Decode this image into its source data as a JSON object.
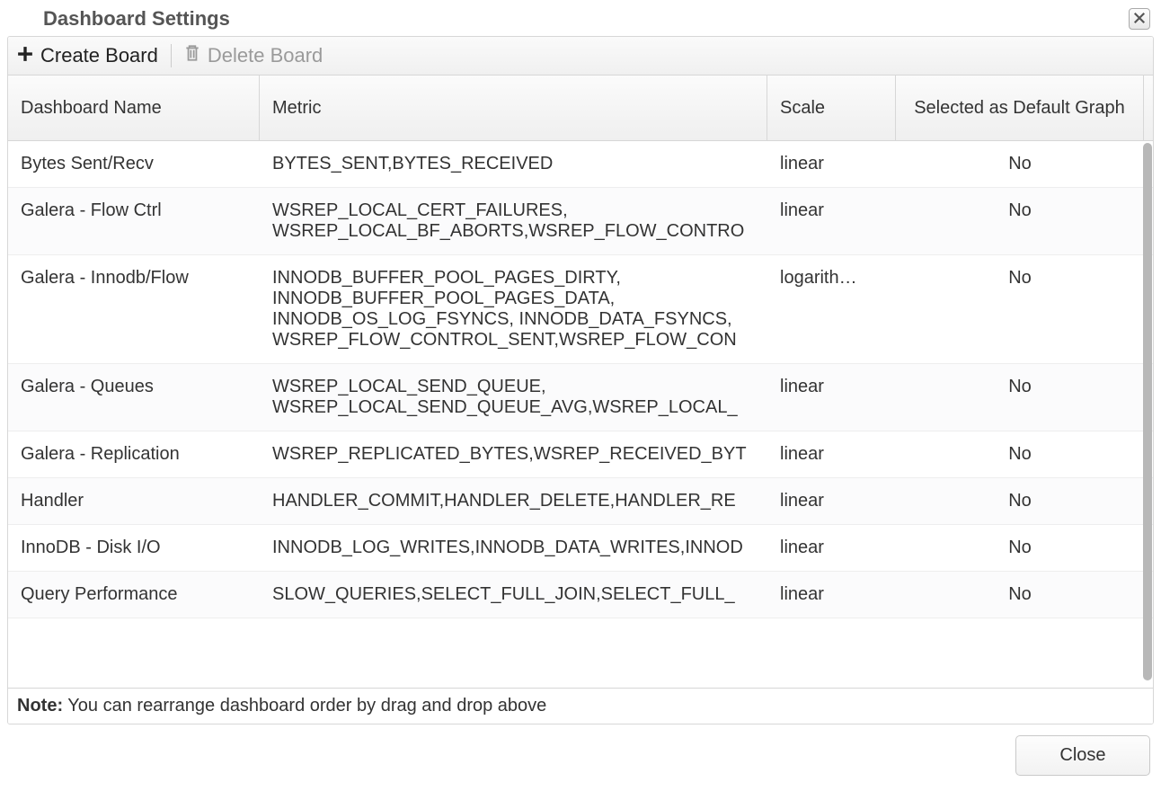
{
  "dialog": {
    "title": "Dashboard Settings"
  },
  "toolbar": {
    "create_label": "Create Board",
    "delete_label": "Delete Board"
  },
  "columns": {
    "name": "Dashboard Name",
    "metric": "Metric",
    "scale": "Scale",
    "default": "Selected as Default Graph"
  },
  "rows": [
    {
      "name": "Bytes Sent/Recv",
      "metric": "BYTES_SENT,BYTES_RECEIVED",
      "scale": "linear",
      "default": "No"
    },
    {
      "name": "Galera - Flow Ctrl",
      "metric": "WSREP_LOCAL_CERT_FAILURES, WSREP_LOCAL_BF_ABORTS,WSREP_FLOW_CONTRO",
      "scale": "linear",
      "default": "No"
    },
    {
      "name": "Galera - Innodb/Flow",
      "metric": "INNODB_BUFFER_POOL_PAGES_DIRTY, INNODB_BUFFER_POOL_PAGES_DATA, INNODB_OS_LOG_FSYNCS, INNODB_DATA_FSYNCS, WSREP_FLOW_CONTROL_SENT,WSREP_FLOW_CON",
      "scale": "logarith…",
      "default": "No"
    },
    {
      "name": "Galera - Queues",
      "metric": "WSREP_LOCAL_SEND_QUEUE, WSREP_LOCAL_SEND_QUEUE_AVG,WSREP_LOCAL_",
      "scale": "linear",
      "default": "No"
    },
    {
      "name": "Galera - Replication",
      "metric": "WSREP_REPLICATED_BYTES,WSREP_RECEIVED_BYT",
      "scale": "linear",
      "default": "No"
    },
    {
      "name": "Handler",
      "metric": "HANDLER_COMMIT,HANDLER_DELETE,HANDLER_RE",
      "scale": "linear",
      "default": "No"
    },
    {
      "name": "InnoDB - Disk I/O",
      "metric": "INNODB_LOG_WRITES,INNODB_DATA_WRITES,INNOD",
      "scale": "linear",
      "default": "No"
    },
    {
      "name": "Query Performance",
      "metric": "SLOW_QUERIES,SELECT_FULL_JOIN,SELECT_FULL_",
      "scale": "linear",
      "default": "No"
    }
  ],
  "note": {
    "label": "Note:",
    "text": " You can rearrange dashboard order by drag and drop above"
  },
  "footer": {
    "close_label": "Close"
  }
}
